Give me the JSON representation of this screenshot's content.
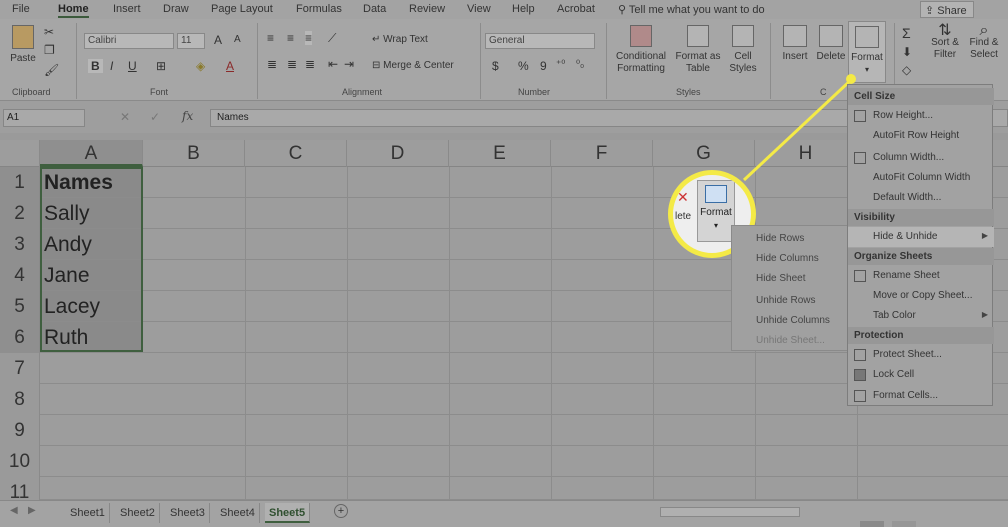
{
  "menu": {
    "items": [
      "File",
      "Home",
      "Insert",
      "Draw",
      "Page Layout",
      "Formulas",
      "Data",
      "Review",
      "View",
      "Help",
      "Acrobat"
    ],
    "active": "Home",
    "tell_me": "Tell me what you want to do",
    "share": "Share"
  },
  "ribbon": {
    "clipboard": {
      "paste": "Paste",
      "label": "Clipboard"
    },
    "font": {
      "name": "Calibri",
      "size": "11",
      "bold": "B",
      "italic": "I",
      "underline": "U",
      "grow": "A",
      "shrink": "A",
      "font_color": "A",
      "label": "Font"
    },
    "alignment": {
      "wrap": "Wrap Text",
      "merge": "Merge & Center",
      "label": "Alignment"
    },
    "number": {
      "format": "General",
      "currency": "$",
      "percent": "%",
      "comma": "9",
      "label": "Number"
    },
    "styles": {
      "conditional": "Conditional Formatting",
      "format_table": "Format as Table",
      "cell_styles": "Cell Styles",
      "label": "Styles"
    },
    "cells": {
      "insert": "Insert",
      "delete": "Delete",
      "format": "Format",
      "label": "C"
    },
    "editing": {
      "sort": "Sort & Filter",
      "find": "Find & Select",
      "sum": "Σ"
    }
  },
  "formula_bar": {
    "name_box": "A1",
    "fx": "fx",
    "value": "Names"
  },
  "columns": [
    "A",
    "B",
    "C",
    "D",
    "E",
    "F",
    "G",
    "H"
  ],
  "rows": [
    {
      "num": "1",
      "a": "Names"
    },
    {
      "num": "2",
      "a": "Sally"
    },
    {
      "num": "3",
      "a": "Andy"
    },
    {
      "num": "4",
      "a": "Jane"
    },
    {
      "num": "5",
      "a": "Lacey"
    },
    {
      "num": "6",
      "a": "Ruth"
    },
    {
      "num": "7",
      "a": ""
    },
    {
      "num": "8",
      "a": ""
    },
    {
      "num": "9",
      "a": ""
    },
    {
      "num": "10",
      "a": ""
    },
    {
      "num": "11",
      "a": ""
    }
  ],
  "sheet_tabs": [
    "Sheet1",
    "Sheet2",
    "Sheet3",
    "Sheet4",
    "Sheet5"
  ],
  "active_tab": "Sheet5",
  "add_sheet": "+",
  "format_menu": {
    "cell_size": "Cell Size",
    "row_height": "Row Height...",
    "autofit_row": "AutoFit Row Height",
    "column_width": "Column Width...",
    "autofit_col": "AutoFit Column Width",
    "default_width": "Default Width...",
    "visibility": "Visibility",
    "hide_unhide": "Hide & Unhide",
    "organize": "Organize Sheets",
    "rename": "Rename Sheet",
    "move_copy": "Move or Copy Sheet...",
    "tab_color": "Tab Color",
    "protection": "Protection",
    "protect": "Protect Sheet...",
    "lock": "Lock Cell",
    "format_cells": "Format Cells..."
  },
  "submenu": [
    "Hide Rows",
    "Hide Columns",
    "Hide Sheet",
    "Unhide Rows",
    "Unhide Columns",
    "Unhide Sheet..."
  ],
  "callout": {
    "label": "Format",
    "partial": "lete",
    "color": "#f4ea46"
  }
}
